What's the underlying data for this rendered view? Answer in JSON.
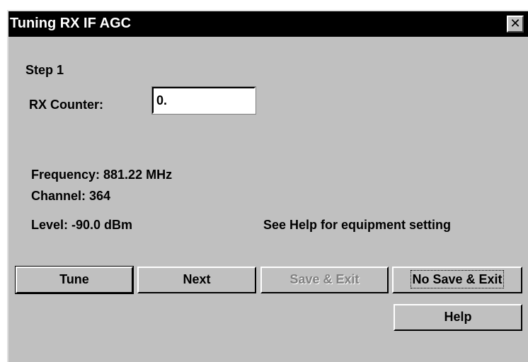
{
  "window": {
    "title": "Tuning RX IF AGC",
    "close_glyph": "✕"
  },
  "step": {
    "label": "Step 1"
  },
  "rx_counter": {
    "label": "RX Counter:",
    "value": "0."
  },
  "info": {
    "frequency": "Frequency: 881.22 MHz",
    "channel": "Channel: 364",
    "level": "Level: -90.0 dBm",
    "help_note": "See Help for equipment setting"
  },
  "buttons": {
    "tune": "Tune",
    "next": "Next",
    "save_exit": "Save & Exit",
    "no_save_exit": "No Save & Exit",
    "help": "Help"
  },
  "colors": {
    "dialog_bg": "#c0c0c0",
    "titlebar_bg": "#000000",
    "titlebar_text": "#ffffff",
    "disabled_text": "#808080"
  }
}
